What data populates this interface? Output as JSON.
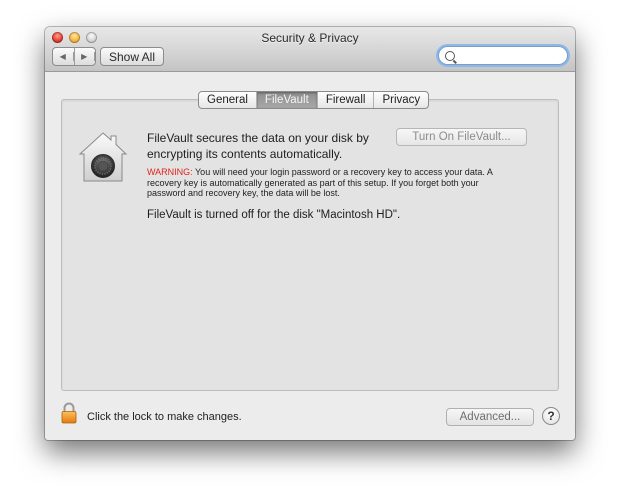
{
  "window": {
    "title": "Security & Privacy",
    "nav_back_icon": "◀",
    "nav_forward_icon": "▶",
    "show_all_label": "Show All",
    "search_value": "",
    "search_placeholder": ""
  },
  "tabs": [
    {
      "label": "General",
      "active": false
    },
    {
      "label": "FileVault",
      "active": true
    },
    {
      "label": "Firewall",
      "active": false
    },
    {
      "label": "Privacy",
      "active": false
    }
  ],
  "filevault": {
    "description": "FileVault secures the data on your disk by encrypting its contents automatically.",
    "turn_on_label": "Turn On FileVault...",
    "warning_prefix": "WARNING:",
    "warning_text": " You will need your login password or a recovery key to access your data. A recovery key is automatically generated as part of this setup. If you forget both your password and recovery key, the data will be lost.",
    "status": "FileVault is turned off for the disk \"Macintosh HD\"."
  },
  "footer": {
    "lock_text": "Click the lock to make changes.",
    "advanced_label": "Advanced...",
    "help_label": "?"
  },
  "colors": {
    "warning_red": "#e0231b",
    "search_focus": "#8fb8e8",
    "lock_orange": "#f0a030"
  }
}
